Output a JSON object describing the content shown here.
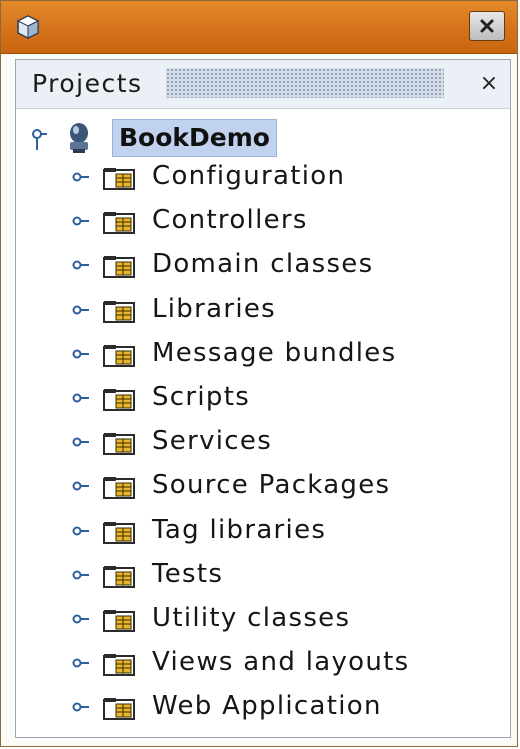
{
  "panel": {
    "title": "Projects",
    "close_glyph": "×"
  },
  "tree": {
    "root": {
      "label": "BookDemo",
      "icon": "grails-project-icon"
    },
    "children": [
      {
        "label": "Configuration",
        "icon": "folder-icon"
      },
      {
        "label": "Controllers",
        "icon": "folder-icon"
      },
      {
        "label": "Domain classes",
        "icon": "folder-icon"
      },
      {
        "label": "Libraries",
        "icon": "folder-icon"
      },
      {
        "label": "Message bundles",
        "icon": "folder-icon"
      },
      {
        "label": "Scripts",
        "icon": "folder-icon"
      },
      {
        "label": "Services",
        "icon": "folder-icon"
      },
      {
        "label": "Source Packages",
        "icon": "folder-icon"
      },
      {
        "label": "Tag libraries",
        "icon": "folder-icon"
      },
      {
        "label": "Tests",
        "icon": "folder-icon"
      },
      {
        "label": "Utility classes",
        "icon": "folder-icon"
      },
      {
        "label": "Views and layouts",
        "icon": "folder-icon"
      },
      {
        "label": "Web Application",
        "icon": "folder-icon"
      }
    ]
  },
  "colors": {
    "titlebar": "#d7761e",
    "selection": "#c1d2ee",
    "folder": "#e9b52b"
  }
}
